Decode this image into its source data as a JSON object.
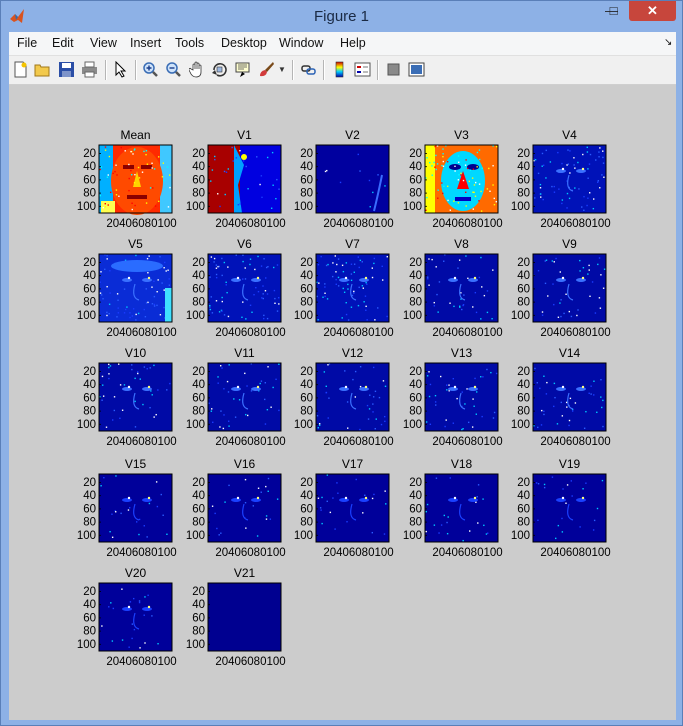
{
  "window": {
    "title": "Figure 1"
  },
  "menubar": {
    "items": [
      "File",
      "Edit",
      "View",
      "Insert",
      "Tools",
      "Desktop",
      "Window",
      "Help"
    ]
  },
  "toolbar": {
    "icons": [
      "new-figure-icon",
      "open-file-icon",
      "save-icon",
      "print-icon",
      "edit-plot-arrow-icon",
      "zoom-in-icon",
      "zoom-out-icon",
      "pan-hand-icon",
      "rotate-3d-icon",
      "data-cursor-icon",
      "brush-icon",
      "brush-dropdown-icon",
      "link-plot-icon",
      "colorbar-icon",
      "legend-icon",
      "hide-plot-tools-icon",
      "show-plot-tools-icon"
    ]
  },
  "figure": {
    "subplots": [
      {
        "title": "Mean",
        "style": "mean"
      },
      {
        "title": "V1",
        "style": "v1"
      },
      {
        "title": "V2",
        "style": "v2"
      },
      {
        "title": "V3",
        "style": "v3"
      },
      {
        "title": "V4",
        "style": "dark"
      },
      {
        "title": "V5",
        "style": "v5"
      },
      {
        "title": "V6",
        "style": "dark"
      },
      {
        "title": "V7",
        "style": "dark"
      },
      {
        "title": "V8",
        "style": "darker"
      },
      {
        "title": "V9",
        "style": "darker"
      },
      {
        "title": "V10",
        "style": "darker"
      },
      {
        "title": "V11",
        "style": "darker"
      },
      {
        "title": "V12",
        "style": "darker"
      },
      {
        "title": "V13",
        "style": "darker"
      },
      {
        "title": "V14",
        "style": "darker"
      },
      {
        "title": "V15",
        "style": "darkest"
      },
      {
        "title": "V16",
        "style": "darkest"
      },
      {
        "title": "V17",
        "style": "darkest"
      },
      {
        "title": "V18",
        "style": "darkest"
      },
      {
        "title": "V19",
        "style": "darkest"
      },
      {
        "title": "V20",
        "style": "darkest"
      },
      {
        "title": "V21",
        "style": "flat"
      }
    ],
    "y_ticks": [
      "20",
      "40",
      "60",
      "80",
      "100"
    ],
    "x_tick_label": "20406080100"
  },
  "colors": {
    "jet_dark_blue": "#00008f",
    "jet_blue": "#0000ff",
    "jet_red": "#b00000",
    "jet_yellow": "#ffff00",
    "figure_bg": "#cccccc"
  }
}
